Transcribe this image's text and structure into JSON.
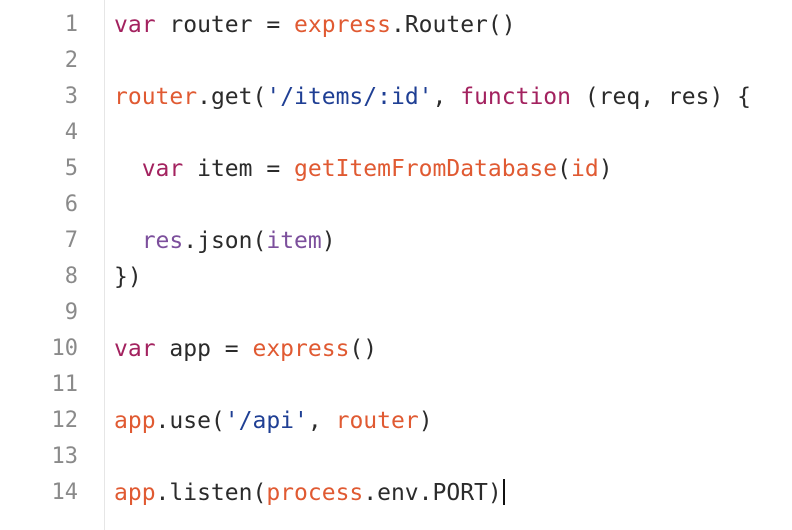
{
  "editor": {
    "theme_colors": {
      "keyword": "#a3225f",
      "call": "#e05a32",
      "string": "#1f3f94",
      "variable": "#7c4f9c",
      "text": "#2b2b2b",
      "line_number": "#8a8a8a",
      "gutter_border": "#e6e6e6"
    },
    "line_numbers": [
      "1",
      "2",
      "3",
      "4",
      "5",
      "6",
      "7",
      "8",
      "9",
      "10",
      "11",
      "12",
      "13",
      "14"
    ],
    "lines": [
      [
        {
          "t": "keyword",
          "v": "var"
        },
        {
          "t": "ident",
          "v": " router = "
        },
        {
          "t": "call",
          "v": "express"
        },
        {
          "t": "ident",
          "v": ".Router()"
        }
      ],
      [],
      [
        {
          "t": "call",
          "v": "router"
        },
        {
          "t": "ident",
          "v": ".get("
        },
        {
          "t": "string",
          "v": "'/items/:id'"
        },
        {
          "t": "ident",
          "v": ", "
        },
        {
          "t": "keyword",
          "v": "function"
        },
        {
          "t": "ident",
          "v": " (req, res) {"
        }
      ],
      [],
      [
        {
          "t": "ident",
          "v": "  "
        },
        {
          "t": "keyword",
          "v": "var"
        },
        {
          "t": "ident",
          "v": " item = "
        },
        {
          "t": "call",
          "v": "getItemFromDatabase"
        },
        {
          "t": "ident",
          "v": "("
        },
        {
          "t": "call",
          "v": "id"
        },
        {
          "t": "ident",
          "v": ")"
        }
      ],
      [],
      [
        {
          "t": "ident",
          "v": "  "
        },
        {
          "t": "var",
          "v": "res"
        },
        {
          "t": "ident",
          "v": ".json("
        },
        {
          "t": "var",
          "v": "item"
        },
        {
          "t": "ident",
          "v": ")"
        }
      ],
      [
        {
          "t": "ident",
          "v": "})"
        }
      ],
      [],
      [
        {
          "t": "keyword",
          "v": "var"
        },
        {
          "t": "ident",
          "v": " app = "
        },
        {
          "t": "call",
          "v": "express"
        },
        {
          "t": "ident",
          "v": "()"
        }
      ],
      [],
      [
        {
          "t": "call",
          "v": "app"
        },
        {
          "t": "ident",
          "v": ".use("
        },
        {
          "t": "string",
          "v": "'/api'"
        },
        {
          "t": "ident",
          "v": ", "
        },
        {
          "t": "call",
          "v": "router"
        },
        {
          "t": "ident",
          "v": ")"
        }
      ],
      [],
      [
        {
          "t": "call",
          "v": "app"
        },
        {
          "t": "ident",
          "v": ".listen("
        },
        {
          "t": "call",
          "v": "process"
        },
        {
          "t": "ident",
          "v": ".env.PORT)"
        }
      ]
    ],
    "cursor_line": 14
  }
}
